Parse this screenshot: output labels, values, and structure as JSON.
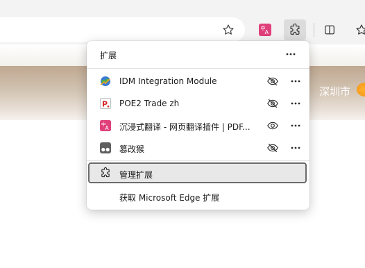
{
  "popup": {
    "title": "扩展",
    "extensions": [
      {
        "name": "IDM Integration Module",
        "visibility_icon": "eye-slash-icon"
      },
      {
        "name": "POE2 Trade zh",
        "visibility_icon": "eye-slash-icon"
      },
      {
        "name": "沉浸式翻译 - 网页翻译插件 | PDF...",
        "visibility_icon": "eye-icon"
      },
      {
        "name": "篡改猴",
        "visibility_icon": "eye-slash-icon"
      }
    ],
    "manage_label": "管理扩展",
    "get_label": "获取 Microsoft Edge 扩展"
  },
  "page": {
    "city": "深圳市"
  },
  "colors": {
    "popup_bg": "#ffffff",
    "toolbar_bg": "#f3f3f3",
    "highlight_border": "#6b6b6b",
    "translate_icon": "#e0407a",
    "poe_icon": "#d9262b"
  }
}
